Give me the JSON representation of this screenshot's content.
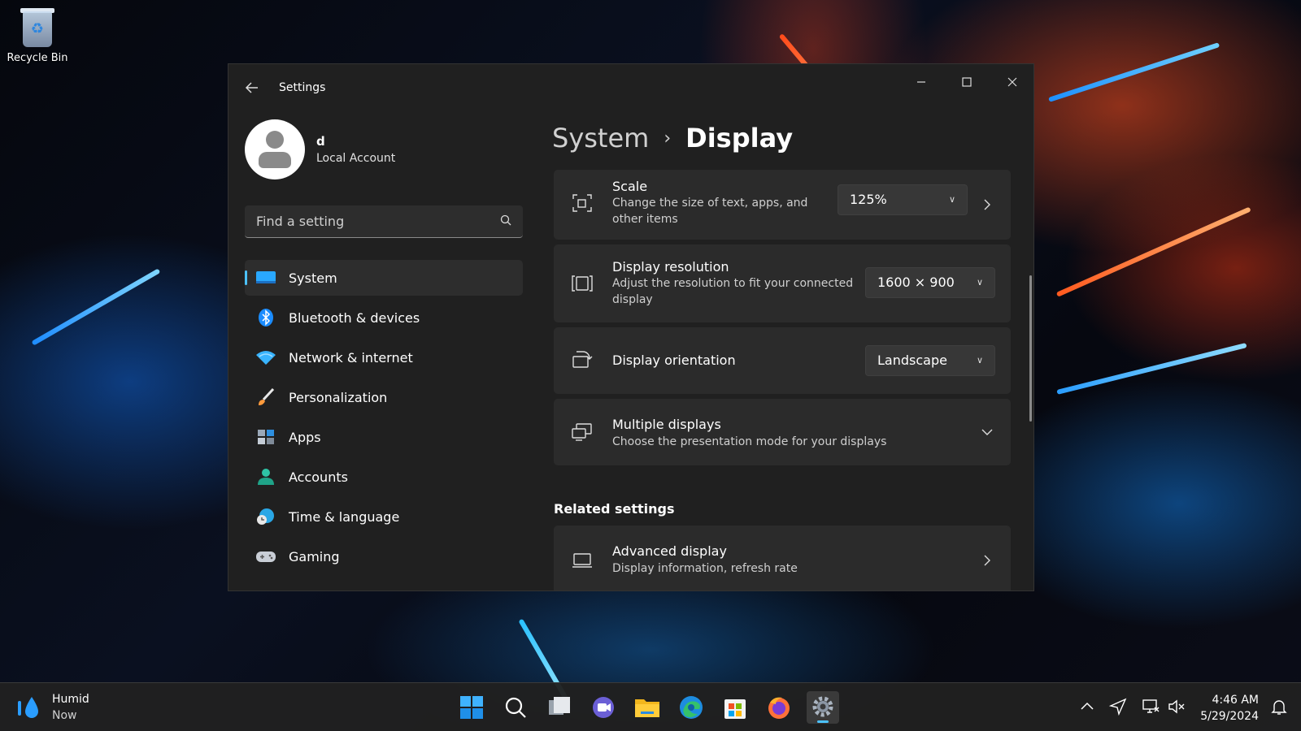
{
  "desktop": {
    "recycle_bin_label": "Recycle Bin"
  },
  "window": {
    "title": "Settings",
    "accent_color": "#4cc2ff"
  },
  "profile": {
    "name": "d",
    "account_type": "Local Account"
  },
  "search": {
    "placeholder": "Find a setting"
  },
  "nav": {
    "items": [
      {
        "label": "System",
        "icon": "system-icon",
        "active": true
      },
      {
        "label": "Bluetooth & devices",
        "icon": "bluetooth-icon"
      },
      {
        "label": "Network & internet",
        "icon": "wifi-icon"
      },
      {
        "label": "Personalization",
        "icon": "brush-icon"
      },
      {
        "label": "Apps",
        "icon": "apps-icon"
      },
      {
        "label": "Accounts",
        "icon": "accounts-icon"
      },
      {
        "label": "Time & language",
        "icon": "globe-clock-icon"
      },
      {
        "label": "Gaming",
        "icon": "gamepad-icon"
      }
    ]
  },
  "breadcrumb": {
    "parent": "System",
    "current": "Display"
  },
  "settings": {
    "scale": {
      "title": "Scale",
      "description": "Change the size of text, apps, and other items",
      "value": "125%"
    },
    "resolution": {
      "title": "Display resolution",
      "description": "Adjust the resolution to fit your connected display",
      "value": "1600 × 900"
    },
    "orientation": {
      "title": "Display orientation",
      "value": "Landscape"
    },
    "multiple": {
      "title": "Multiple displays",
      "description": "Choose the presentation mode for your displays"
    },
    "related_header": "Related settings",
    "advanced": {
      "title": "Advanced display",
      "description": "Display information, refresh rate"
    }
  },
  "taskbar": {
    "weather_condition": "Humid",
    "weather_time": "Now",
    "time": "4:46 AM",
    "date": "5/29/2024"
  }
}
